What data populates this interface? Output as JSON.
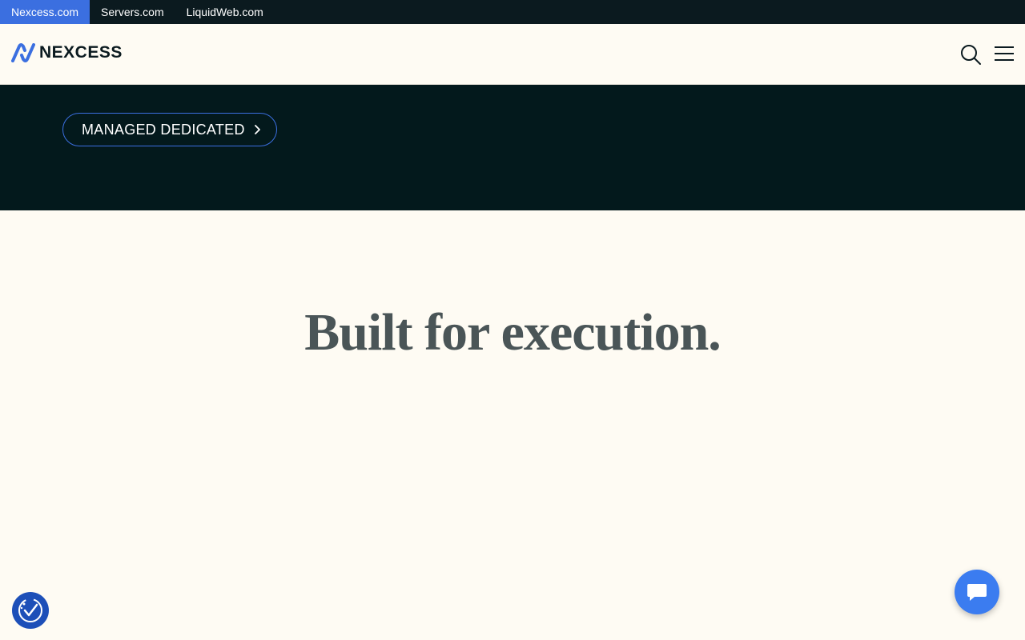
{
  "topbar": {
    "links": [
      {
        "label": "Nexcess.com",
        "active": true
      },
      {
        "label": "Servers.com",
        "active": false
      },
      {
        "label": "LiquidWeb.com",
        "active": false
      }
    ]
  },
  "header": {
    "logo_text": "NEXCESS",
    "search_icon": "search-icon",
    "menu_icon": "hamburger-menu-icon"
  },
  "hero": {
    "cta_label": "MANAGED DEDICATED"
  },
  "main": {
    "headline": "Built for execution."
  },
  "widgets": {
    "accessibility_icon": "accessibility-icon",
    "chat_icon": "chat-bubble-icon"
  },
  "colors": {
    "accent": "#3b6fe0",
    "dark": "#03191c",
    "background": "#fefbf3",
    "chat": "#3b7cf0"
  }
}
